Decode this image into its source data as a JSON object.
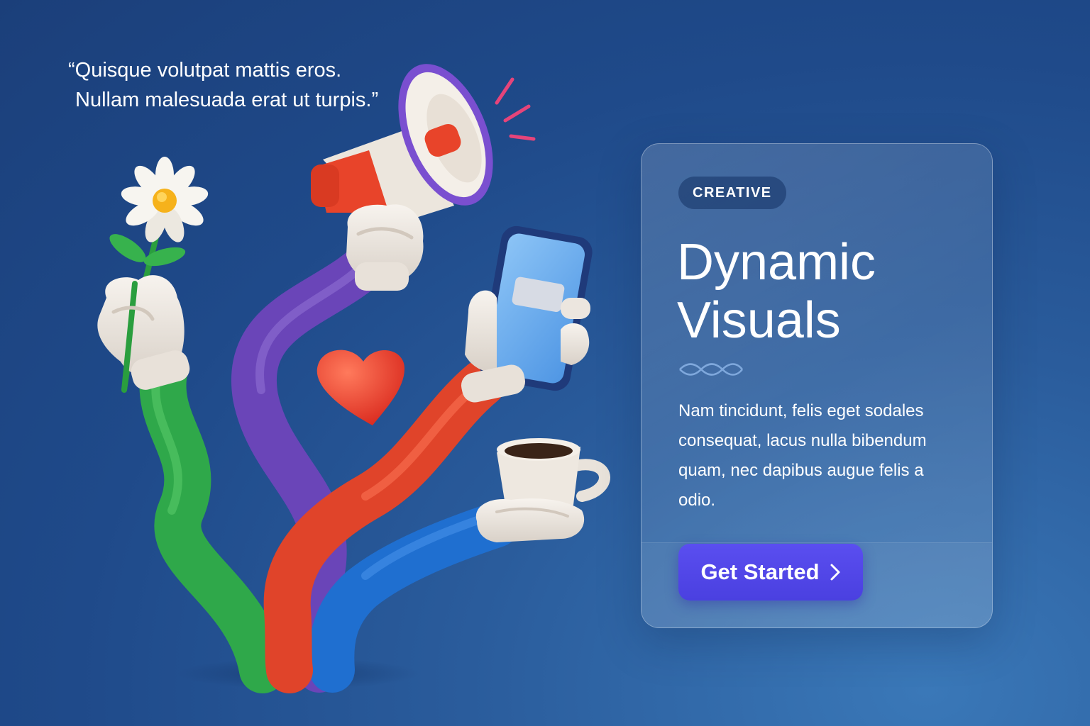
{
  "quote": {
    "line1": "“Quisque volutpat mattis eros.",
    "line2": "Nullam malesuada erat ut turpis.”"
  },
  "card": {
    "badge": "CREATIVE",
    "title_line1": "Dynamic",
    "title_line2": "Visuals",
    "body": "Nam tincidunt, felis eget sodales consequat, lacus nulla bibendum quam, nec dapibus augue felis a odio.",
    "cta_label": "Get Started",
    "cta_icon": "chevron-right-icon"
  },
  "illustration": {
    "items": [
      "daisy-flower-icon",
      "megaphone-icon",
      "smartphone-icon",
      "heart-icon",
      "coffee-cup-icon"
    ],
    "colors": {
      "green_arm": "#2fa84a",
      "purple_arm": "#6a45b8",
      "red_arm": "#e0442a",
      "blue_arm": "#1f6fd0",
      "glove": "#efe9e2",
      "heart": "#ee3b2b",
      "phone_screen": "#6aaef0",
      "accent_button": "#5047e6"
    }
  }
}
